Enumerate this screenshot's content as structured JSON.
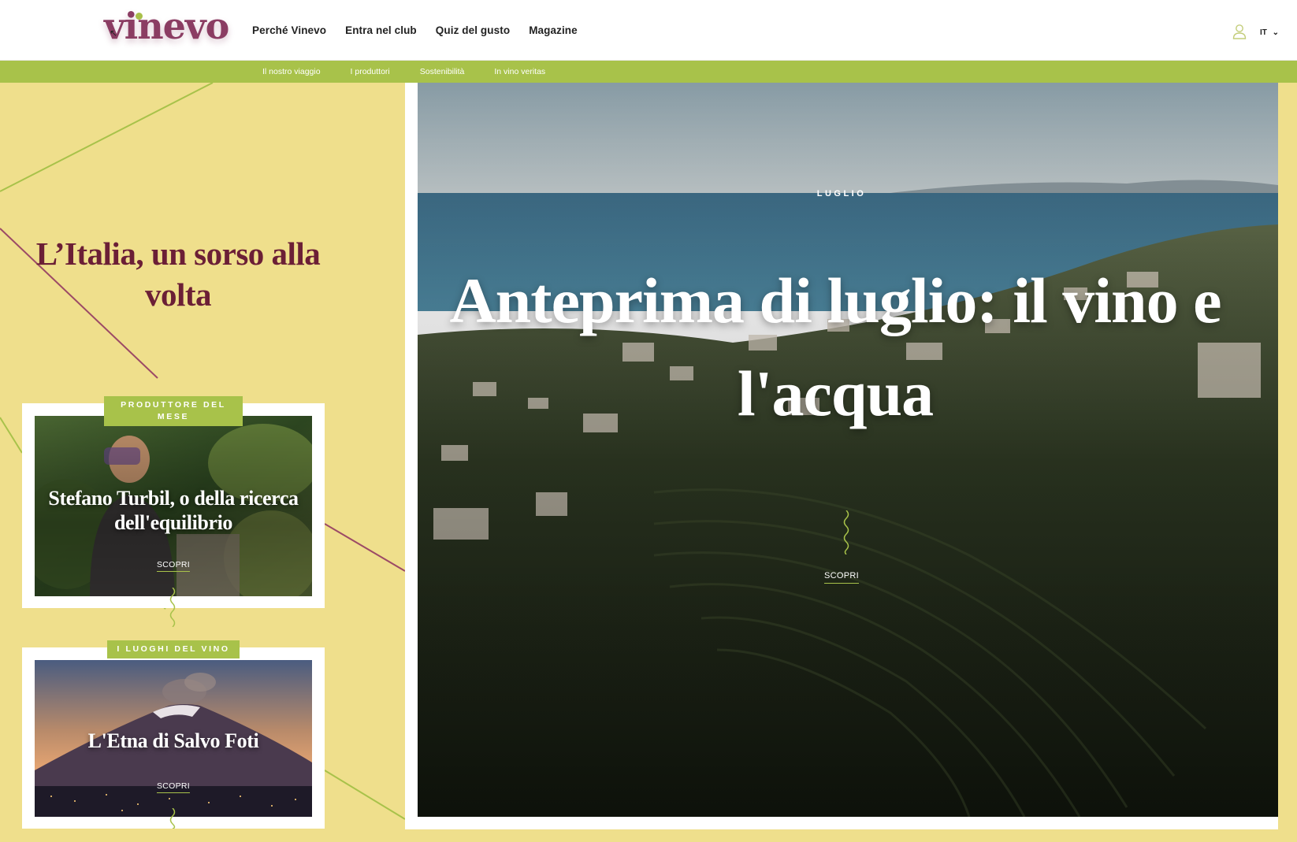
{
  "header": {
    "logo": "vinevo",
    "nav": [
      "Perché Vinevo",
      "Entra nel club",
      "Quiz del gusto",
      "Magazine"
    ],
    "user_icon": "user-icon",
    "language": "IT",
    "language_icon": "chevron-down-icon"
  },
  "subnav": {
    "items": [
      "Il nostro viaggio",
      "I produttori",
      "Sostenibilità",
      "In vino veritas"
    ]
  },
  "intro": {
    "tagline": "L’Italia, un sorso alla volta"
  },
  "cards": [
    {
      "badge": "PRODUTTORE DEL MESE",
      "title": "Stefano Turbil, o della ricerca dell'equilibrio",
      "cta": "SCOPRI"
    },
    {
      "badge": "I LUOGHI DEL VINO",
      "title": "L'Etna di Salvo Foti",
      "cta": "SCOPRI"
    }
  ],
  "hero": {
    "month": "LUGLIO",
    "title": "Anteprima di luglio: il vino e l'acqua",
    "cta": "SCOPRI"
  },
  "colors": {
    "background": "#efdf8c",
    "accent_green": "#a8c24a",
    "wine": "#6b1f36",
    "logo": "#8b3d63"
  }
}
